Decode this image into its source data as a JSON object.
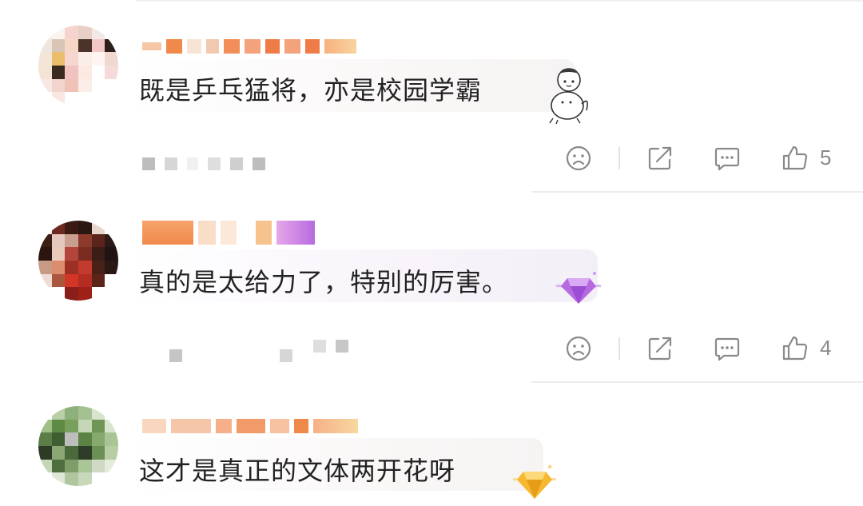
{
  "comments": [
    {
      "text": "既是乒乓猛将，亦是校园学霸",
      "likes": "5",
      "badge_icon": "cartoon-cat-girl-sticker"
    },
    {
      "text": "真的是太给力了，特别的厉害。",
      "likes": "4",
      "badge_icon": "purple-diamond-badge"
    },
    {
      "text": "这才是真正的文体两开花呀",
      "likes": "",
      "badge_icon": "gold-diamond-badge"
    }
  ],
  "colors": {
    "text": "#222222",
    "icon": "#8a8a8a",
    "username_orange": "#f08a4b",
    "purple_badge": "#b66ae0",
    "gold_badge": "#f5b82e"
  }
}
